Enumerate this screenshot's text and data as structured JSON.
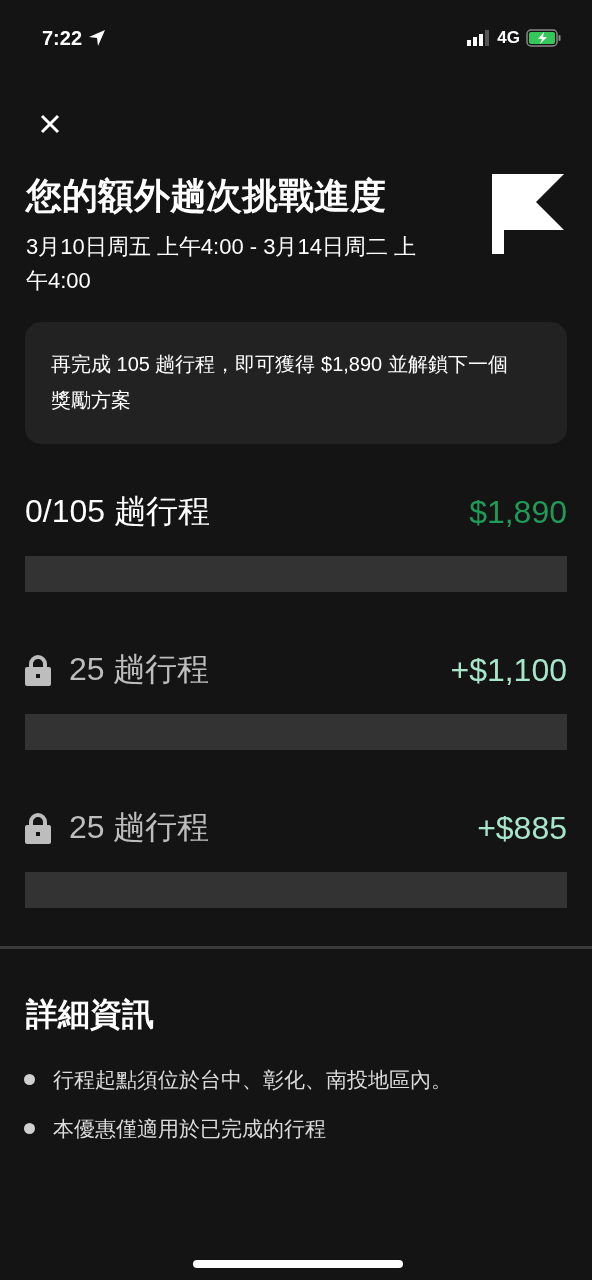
{
  "status_bar": {
    "time": "7:22",
    "network": "4G"
  },
  "header": {
    "title": "您的額外趟次挑戰進度",
    "date_range": "3月10日周五 上午4:00 - 3月14日周二 上午4:00"
  },
  "notice": "再完成 105 趟行程，即可獲得 $1,890 並解鎖下一個獎勵方案",
  "tiers": [
    {
      "label": "0/105 趟行程",
      "amount": "$1,890",
      "locked": false,
      "level": 0
    },
    {
      "label": "25 趟行程",
      "amount": "+$1,100",
      "locked": true,
      "level": 0
    },
    {
      "label": "25 趟行程",
      "amount": "+$885",
      "locked": true,
      "level": 0
    }
  ],
  "details": {
    "title": "詳細資訊",
    "items": [
      "行程起點須位於台中、彰化、南投地區內。",
      "本優惠僅適用於已完成的行程"
    ]
  }
}
